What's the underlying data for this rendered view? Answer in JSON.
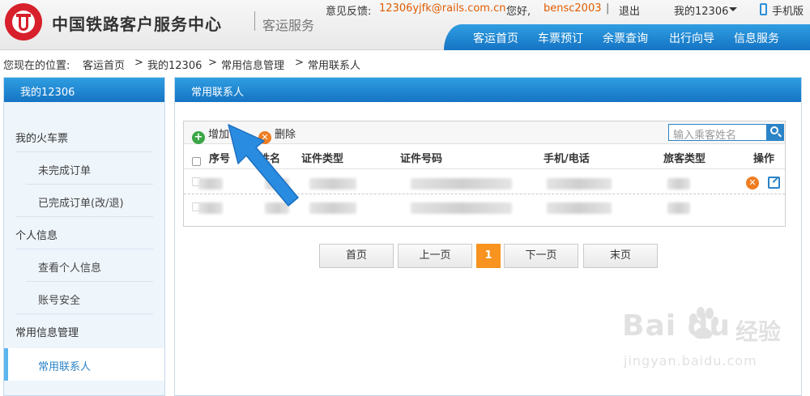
{
  "header": {
    "brand": "中国铁路客户服务中心",
    "brand_sub": "客运服务",
    "feedback_label": "意见反馈:",
    "feedback_email": "12306yjfk@rails.com.cn",
    "hello": "您好,",
    "username": "bensc2003",
    "separator": "|",
    "logout": "退出",
    "my_account": "我的12306",
    "mobile": "手机版",
    "nav": [
      "客运首页",
      "车票预订",
      "余票查询",
      "出行向导",
      "信息服务"
    ]
  },
  "breadcrumb": {
    "prefix": "您现在的位置:",
    "items": [
      "客运首页",
      "我的12306",
      "常用信息管理",
      "常用联系人"
    ],
    "sep": ">"
  },
  "sidebar": {
    "title": "我的12306",
    "rows": [
      {
        "label": "我的火车票",
        "kind": "group"
      },
      {
        "label": "未完成订单",
        "kind": "item"
      },
      {
        "label": "已完成订单(改/退)",
        "kind": "item"
      },
      {
        "label": "个人信息",
        "kind": "group"
      },
      {
        "label": "查看个人信息",
        "kind": "item"
      },
      {
        "label": "账号安全",
        "kind": "item"
      },
      {
        "label": "常用信息管理",
        "kind": "group"
      },
      {
        "label": "常用联系人",
        "kind": "item",
        "active": true
      }
    ]
  },
  "main": {
    "title": "常用联系人",
    "toolbar": {
      "add": "增加",
      "delete": "删除"
    },
    "search": {
      "placeholder": "输入乘客姓名"
    },
    "columns": [
      "序号",
      "姓名",
      "证件类型",
      "证件号码",
      "手机/电话",
      "旅客类型",
      "操作"
    ],
    "pagination": {
      "first": "首页",
      "prev": "上一页",
      "current": "1",
      "next": "下一页",
      "last": "末页"
    }
  },
  "watermark": {
    "brand": "Bai  du",
    "cn": "经验",
    "url": "jingyan.baidu.com"
  },
  "colors": {
    "accent_blue": "#1f8ad6",
    "highlight_orange": "#f7931e",
    "link_orange": "#e05c00"
  }
}
